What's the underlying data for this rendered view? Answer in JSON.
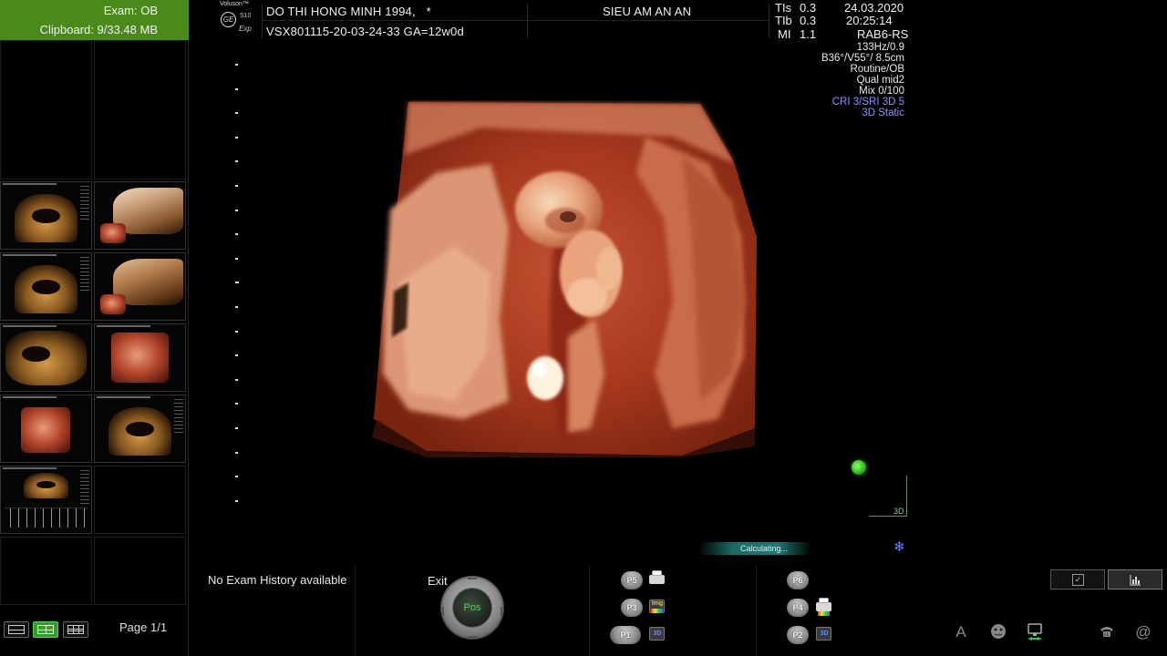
{
  "exam": {
    "label": "Exam:",
    "value": "OB"
  },
  "clipboard": {
    "label": "Clipboard:",
    "value": "9/33.48 MB"
  },
  "logo": {
    "brand": "Voluson™",
    "ge": "GE",
    "model": "S10",
    "edition": "Exp"
  },
  "patient": {
    "name": "DO THI HONG MINH 1994,",
    "flag": "*",
    "id_ga": "VSX801115-20-03-24-33  GA=12w0d"
  },
  "clinic": "SIEU AM AN AN",
  "metrics": {
    "tis_label": "TIs",
    "tis": "0.3",
    "tib_label": "TIb",
    "tib": "0.3",
    "mi_label": "MI",
    "mi": "1.1"
  },
  "datetime": {
    "date": "24.03.2020",
    "time": "20:25:14"
  },
  "probe": "RAB6-RS",
  "params": {
    "p1": "133Hz/0.9",
    "p2": "B36°/V55°/ 8.5cm",
    "p3": "Routine/OB",
    "p4": "Qual mid2",
    "p5": "Mix 0/100",
    "p6": "CRI 3/SRI 3D 5",
    "p7": "3D Static"
  },
  "render": {
    "axis_label": "3D",
    "progress_label": "Calculating..."
  },
  "bottom": {
    "exam_history": "No Exam History available",
    "exit": "Exit",
    "pos": "Pos",
    "buttons": {
      "p5": "P5",
      "p3": "P3",
      "p1": "P1",
      "p6": "P6",
      "p4": "P4",
      "p2": "P2",
      "img": "Img",
      "three_d_a": "3D",
      "three_d_b": "3D"
    }
  },
  "pager": {
    "label": "Page 1/1"
  },
  "sys_icons": {
    "text": "A",
    "at": "@"
  },
  "colors": {
    "exam_header": "#4a8a1a",
    "active_layout": "#2fa02a",
    "status_dot": "#2fb21e",
    "param_blue": "#8f8fff",
    "progress": "#1f7873"
  }
}
